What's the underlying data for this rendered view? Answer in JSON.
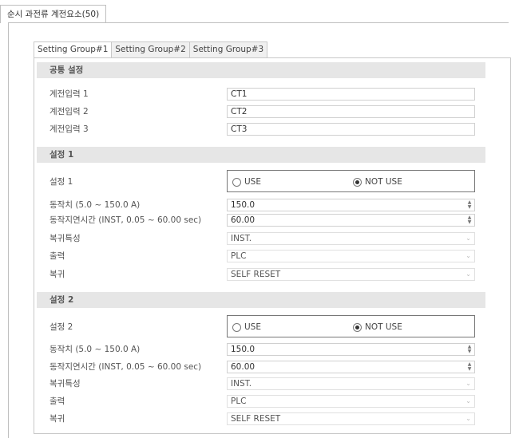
{
  "window": {
    "title": "순시 과전류 계전요소(50)"
  },
  "tabs": [
    {
      "label": "Setting Group#1",
      "active": true
    },
    {
      "label": "Setting Group#2",
      "active": false
    },
    {
      "label": "Setting Group#3",
      "active": false
    }
  ],
  "common": {
    "header": "공통 설정",
    "rows": [
      {
        "label": "계전입력 1",
        "value": "CT1"
      },
      {
        "label": "계전입력 2",
        "value": "CT2"
      },
      {
        "label": "계전입력 3",
        "value": "CT3"
      }
    ]
  },
  "setting1": {
    "header": "설정 1",
    "enable_label": "설정 1",
    "use_label": "USE",
    "notuse_label": "NOT USE",
    "selected": "NOT USE",
    "pickup_label": "동작치 (5.0 ~ 150.0 A)",
    "pickup_value": "150.0",
    "delay_label": "동작지연시간 (INST, 0.05 ~ 60.00 sec)",
    "delay_value": "60.00",
    "reset_char_label": "복귀특성",
    "reset_char_value": "INST.",
    "output_label": "출력",
    "output_value": "PLC",
    "reset_label": "복귀",
    "reset_value": "SELF RESET"
  },
  "setting2": {
    "header": "설정 2",
    "enable_label": "설정 2",
    "use_label": "USE",
    "notuse_label": "NOT USE",
    "selected": "NOT USE",
    "pickup_label": "동작치 (5.0 ~ 150.0 A)",
    "pickup_value": "150.0",
    "delay_label": "동작지연시간 (INST, 0.05 ~ 60.00 sec)",
    "delay_value": "60.00",
    "reset_char_label": "복귀특성",
    "reset_char_value": "INST.",
    "output_label": "출력",
    "output_value": "PLC",
    "reset_label": "복귀",
    "reset_value": "SELF RESET"
  }
}
